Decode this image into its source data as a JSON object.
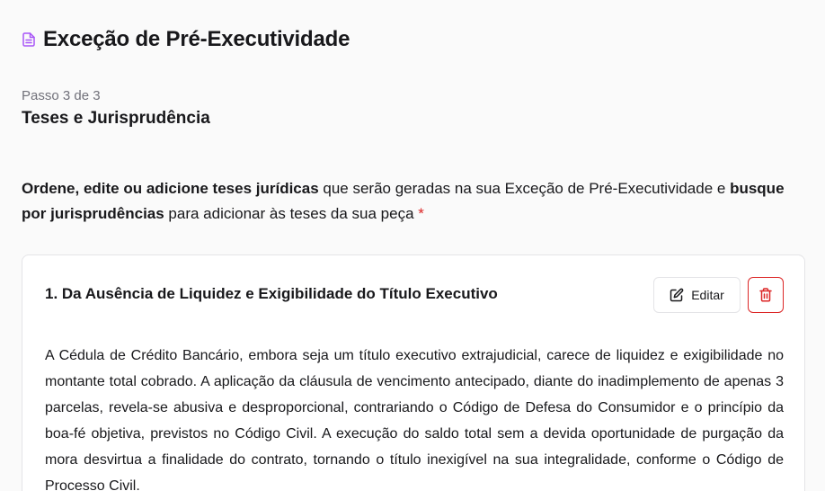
{
  "header": {
    "icon": "document-icon",
    "title": "Exceção de Pré-Executividade",
    "accent_color": "#a855f7"
  },
  "step": {
    "label": "Passo 3 de 3",
    "title": "Teses e Jurisprudência"
  },
  "instructions": {
    "part1_bold": "Ordene, edite ou adicione teses jurídicas",
    "part2": " que serão geradas na sua Exceção de Pré-Executividade e ",
    "part3_bold": "busque por jurisprudências",
    "part4": " para adicionar às teses da sua peça",
    "required_mark": " *"
  },
  "thesis": {
    "title": "1. Da Ausência de Liquidez e Exigibilidade do Título Executivo",
    "edit_label": "Editar",
    "edit_icon": "pencil-square-icon",
    "delete_icon": "trash-icon",
    "delete_color": "#dc2626",
    "body": "A Cédula de Crédito Bancário, embora seja um título executivo extrajudicial, carece de liquidez e exigibilidade no montante total cobrado. A aplicação da cláusula de vencimento antecipado, diante do inadimplemento de apenas 3 parcelas, revela-se abusiva e desproporcional, contrariando o Código de Defesa do Consumidor e o princípio da boa-fé objetiva, previstos no Código Civil. A execução do saldo total sem a devida oportunidade de purgação da mora desvirtua a finalidade do contrato, tornando o título inexigível na sua integralidade, conforme o Código de Processo Civil."
  }
}
